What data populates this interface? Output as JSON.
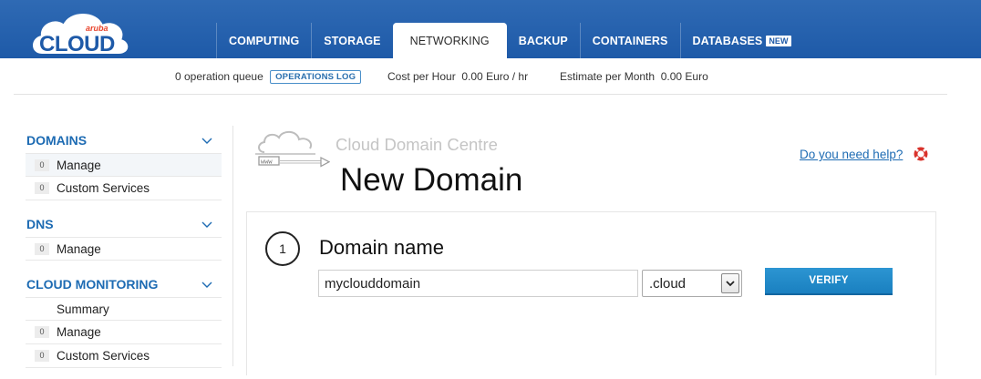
{
  "brand": {
    "name": "CLOUD",
    "subname": "aruba"
  },
  "nav": {
    "tabs": [
      {
        "label": "COMPUTING"
      },
      {
        "label": "STORAGE"
      },
      {
        "label": "NETWORKING",
        "active": true
      },
      {
        "label": "BACKUP"
      },
      {
        "label": "CONTAINERS"
      },
      {
        "label": "DATABASES",
        "badge": "NEW"
      }
    ]
  },
  "status": {
    "queue_text": "0 operation queue",
    "ops_log_label": "OPERATIONS LOG",
    "cost_hour_label": "Cost per Hour",
    "cost_hour_value": "0.00 Euro / hr",
    "estimate_label": "Estimate per Month",
    "estimate_value": "0.00 Euro"
  },
  "sidebar": {
    "sections": [
      {
        "title": "DOMAINS",
        "items": [
          {
            "count": "0",
            "label": "Manage",
            "active": true
          },
          {
            "count": "0",
            "label": "Custom Services"
          }
        ]
      },
      {
        "title": "DNS",
        "items": [
          {
            "count": "0",
            "label": "Manage"
          }
        ]
      },
      {
        "title": "CLOUD MONITORING",
        "items": [
          {
            "count": "",
            "label": "Summary"
          },
          {
            "count": "0",
            "label": "Manage"
          },
          {
            "count": "0",
            "label": "Custom Services"
          }
        ]
      }
    ]
  },
  "main": {
    "section_title": "Cloud Domain Centre",
    "page_title": "New Domain",
    "help_link": "Do you need help?",
    "illustration_text": "www",
    "form": {
      "step_number": "1",
      "field_title": "Domain name",
      "domain_value": "myclouddomain",
      "tld_selected": ".cloud",
      "verify_label": "VERIFY"
    }
  },
  "colors": {
    "header_blue": "#1e5aa8",
    "link_blue": "#1d6bb3",
    "button_blue": "#1a80c0",
    "lifebuoy_red": "#d9322b"
  },
  "icons": {
    "logo": "aruba-cloud-logo",
    "chevron": "chevron-down-icon",
    "help": "lifebuoy-icon",
    "illustration": "cloud-domain-icon",
    "select_arrow": "chevron-down-icon"
  }
}
